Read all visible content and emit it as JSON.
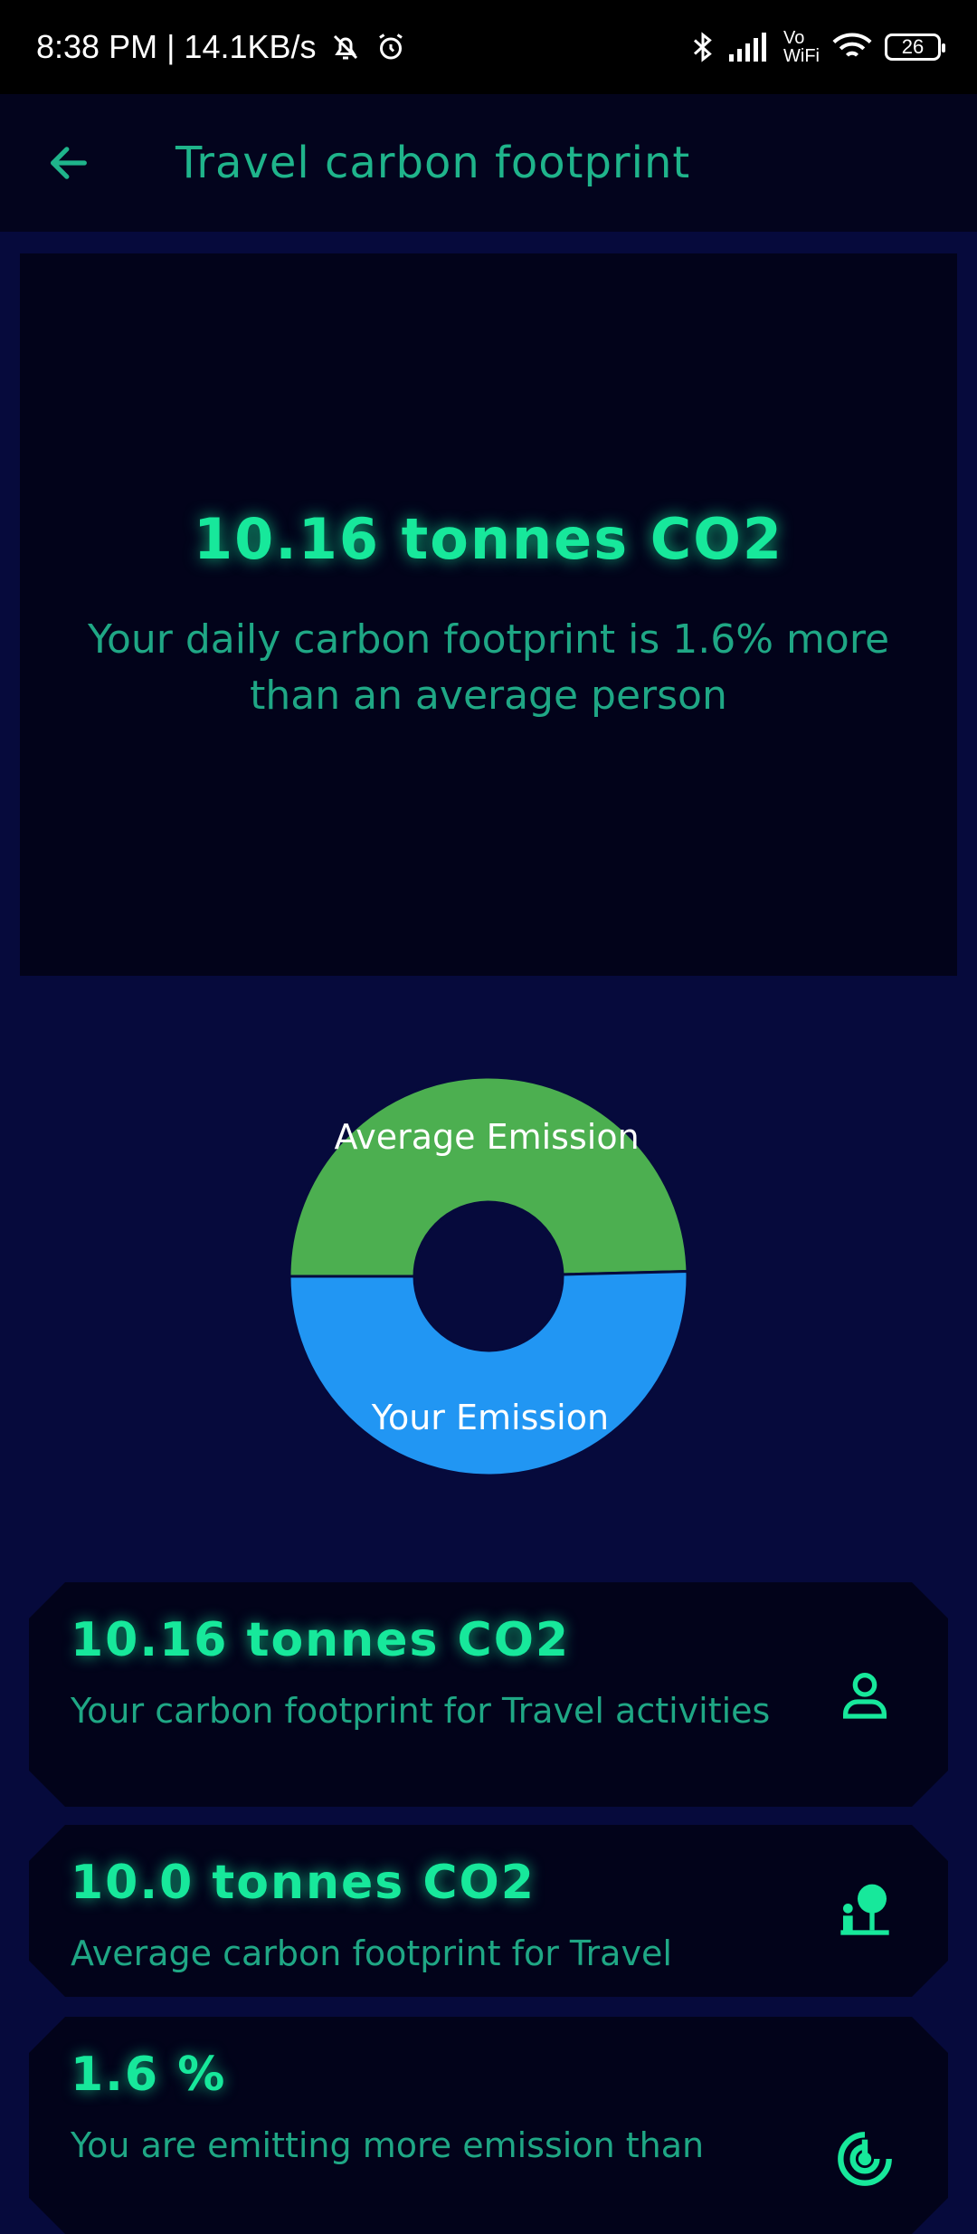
{
  "status_bar": {
    "time_speed": "8:38 PM | 14.1KB/s",
    "network_label": "Vo WiFi",
    "battery": "26"
  },
  "app_bar": {
    "title": "Travel carbon footprint",
    "back_icon": "arrow-left-icon"
  },
  "summary": {
    "value": "10.16 tonnes CO2",
    "text": "Your daily carbon footprint is 1.6% more than an average person"
  },
  "chart_data": {
    "type": "pie",
    "categories": [
      "Average Emission",
      "Your Emission"
    ],
    "values": [
      10.0,
      10.16
    ],
    "colors": [
      "#4caf50",
      "#2196f3"
    ],
    "donut": true
  },
  "cards": [
    {
      "value": "10.16 tonnes CO2",
      "description": "Your carbon footprint for Travel activities",
      "icon": "person-icon"
    },
    {
      "value": "10.0 tonnes CO2",
      "description": "Average carbon footprint for Travel",
      "icon": "person-tree-icon"
    },
    {
      "value": "1.6 %",
      "description": "You are emitting more emission than",
      "icon": "target-icon"
    }
  ],
  "colors": {
    "accent": "#17e89b",
    "text_muted": "#1fa785",
    "background": "#060a3c",
    "card": "#02031a"
  }
}
